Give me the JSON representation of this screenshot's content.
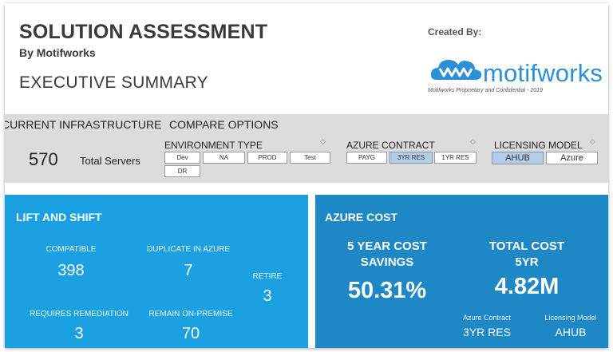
{
  "header": {
    "title": "SOLUTION ASSESSMENT",
    "byline": "By Motifworks",
    "subtitle": "EXECUTIVE SUMMARY",
    "created_by": "Created By:",
    "logo_text": "motifworks",
    "logo_tagline": "Motifworks Proprietary and Confidential - 2019",
    "brand_color": "#2d8fd6"
  },
  "filters": {
    "current_infra_label": "CURRENT INFRASTRUCTURE",
    "compare_label": "COMPARE OPTIONS",
    "total_servers_value": "570",
    "total_servers_label": "Total Servers",
    "environment": {
      "label": "ENVIRONMENT TYPE",
      "options": [
        "Dev",
        "NA",
        "PROD",
        "Test",
        "DR"
      ]
    },
    "azure_contract": {
      "label": "AZURE CONTRACT",
      "options": [
        "PAYG",
        "3YR RES",
        "1YR RES"
      ],
      "selected": "3YR RES"
    },
    "licensing_model": {
      "label": "LICENSING MODEL",
      "options": [
        "AHUB",
        "Azure"
      ],
      "selected": "AHUB"
    },
    "clear_icon": "eraser-icon"
  },
  "lift_shift": {
    "title": "LIFT AND SHIFT",
    "compatible_label": "COMPATIBLE",
    "compatible_value": "398",
    "duplicate_label": "DUPLICATE IN AZURE",
    "duplicate_value": "7",
    "retire_label": "RETIRE",
    "retire_value": "3",
    "remediation_label": "REQUIRES REMEDIATION",
    "remediation_value": "3",
    "onprem_label": "REMAIN ON-PREMISE",
    "onprem_value": "70",
    "color": "#1ba1e2"
  },
  "azure_cost": {
    "title": "AZURE COST",
    "savings_label_1": "5 YEAR COST",
    "savings_label_2": "SAVINGS",
    "savings_value": "50.31%",
    "total_label_1": "TOTAL COST",
    "total_label_2": "5YR",
    "total_value": "4.82M",
    "contract_label": "Azure Contract",
    "contract_value": "3YR RES",
    "licensing_label": "Licensing Model",
    "licensing_value": "AHUB",
    "color": "#1e88c7"
  }
}
